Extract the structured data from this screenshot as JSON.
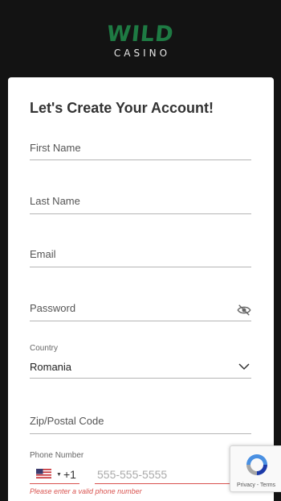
{
  "brand": {
    "logo_main": "WILD",
    "logo_sub": "CASINO"
  },
  "form": {
    "title": "Let's Create Your Account!",
    "first_name": {
      "placeholder": "First Name"
    },
    "last_name": {
      "placeholder": "Last Name"
    },
    "email": {
      "placeholder": "Email"
    },
    "password": {
      "placeholder": "Password",
      "toggle_icon": "eye-off-icon"
    },
    "country": {
      "label": "Country",
      "selected": "Romania",
      "icon": "chevron-down-icon"
    },
    "zip": {
      "placeholder": "Zip/Postal Code"
    },
    "phone": {
      "label": "Phone Number",
      "flag_icon": "us-flag-icon",
      "dial_code": "+1",
      "placeholder": "555-555-5555",
      "error": "Please enter a valid phone number"
    }
  },
  "recaptcha": {
    "links": "Privacy - Terms"
  },
  "colors": {
    "background": "#131313",
    "brand_green": "#1e7a43",
    "error": "#d9534f",
    "card": "#ffffff"
  }
}
